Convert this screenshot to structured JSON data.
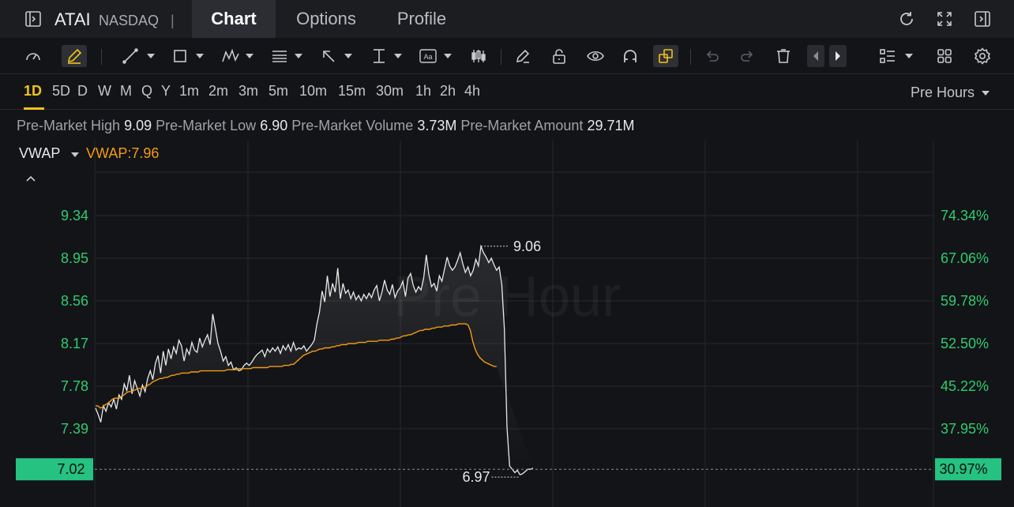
{
  "header": {
    "ticker": "ATAI",
    "exchange": "NASDAQ",
    "separator": "|",
    "tabs": [
      {
        "label": "Chart",
        "active": true
      },
      {
        "label": "Options",
        "active": false
      },
      {
        "label": "Profile",
        "active": false
      }
    ]
  },
  "toolbar": {
    "tools": [
      "speedometer-icon",
      "draw-pencil-icon",
      "trend-line-icon",
      "rectangle-icon",
      "pattern-icon",
      "fib-icon",
      "arrow-icon",
      "measure-icon",
      "text-icon",
      "candles-icon",
      "eraser-icon",
      "unlock-icon",
      "eye-icon",
      "magnet-icon",
      "link-icon",
      "undo-icon",
      "redo-icon",
      "trash-icon",
      "prev-icon",
      "next-icon",
      "layout-list-icon",
      "grid-icon",
      "gear-icon"
    ]
  },
  "intervals": {
    "items": [
      "1D",
      "5D",
      "D",
      "W",
      "M",
      "Q",
      "Y",
      "1m",
      "2m",
      "3m",
      "5m",
      "10m",
      "15m",
      "30m",
      "1h",
      "2h",
      "4h"
    ],
    "active": "1D",
    "session": "Pre Hours"
  },
  "info": {
    "high_label": "Pre-Market High",
    "high_value": "9.09",
    "low_label": "Pre-Market Low",
    "low_value": "6.90",
    "volume_label": "Pre-Market Volume",
    "volume_value": "3.73M",
    "amount_label": "Pre-Market Amount",
    "amount_value": "29.71M"
  },
  "indicator": {
    "name": "VWAP",
    "value_text": "VWAP:7.96"
  },
  "colors": {
    "price_line": "#e8e8e8",
    "vwap_line": "#f39c12",
    "axis_text": "#2ecc71",
    "current_badge": "#26c281",
    "accent": "#f0c419"
  },
  "chart_data": {
    "type": "line",
    "watermark": "Pre Hour",
    "y_ticks": [
      "9.34",
      "8.95",
      "8.56",
      "8.17",
      "7.78",
      "7.39"
    ],
    "y_ticks_right": [
      "74.34%",
      "67.06%",
      "59.78%",
      "52.50%",
      "45.22%",
      "37.95%"
    ],
    "current_price": "7.02",
    "current_pct": "30.97%",
    "high_marker": "9.06",
    "low_marker": "6.97",
    "ylim": [
      6.8,
      9.6
    ],
    "series": [
      {
        "role": "price",
        "values": [
          7.58,
          7.52,
          7.45,
          7.6,
          7.55,
          7.63,
          7.59,
          7.66,
          7.57,
          7.7,
          7.66,
          7.8,
          7.74,
          7.88,
          7.71,
          7.83,
          7.76,
          7.69,
          7.79,
          7.73,
          7.85,
          7.92,
          7.84,
          7.99,
          8.06,
          7.9,
          8.1,
          7.97,
          8.12,
          8.03,
          8.14,
          8.08,
          8.2,
          8.15,
          8.01,
          8.12,
          8.07,
          8.18,
          8.11,
          8.09,
          8.22,
          8.14,
          8.2,
          8.25,
          8.16,
          8.44,
          8.31,
          8.17,
          8.1,
          8.01,
          8.05,
          7.97,
          8.0,
          7.93,
          7.95,
          7.92,
          7.93,
          7.97,
          7.99,
          7.97,
          8.0,
          8.04,
          8.07,
          8.09,
          8.11,
          8.05,
          8.12,
          8.09,
          8.13,
          8.1,
          8.14,
          8.08,
          8.15,
          8.11,
          8.16,
          8.1,
          8.18,
          8.11,
          8.13,
          8.12,
          8.15,
          8.1,
          8.13,
          8.16,
          8.2,
          8.35,
          8.46,
          8.65,
          8.55,
          8.79,
          8.6,
          8.72,
          8.64,
          8.86,
          8.58,
          8.72,
          8.63,
          8.66,
          8.58,
          8.64,
          8.57,
          8.61,
          8.56,
          8.62,
          8.58,
          8.63,
          8.59,
          8.66,
          8.7,
          8.56,
          8.64,
          8.75,
          8.66,
          8.62,
          8.71,
          8.59,
          8.65,
          8.68,
          8.74,
          8.6,
          8.77,
          8.81,
          8.7,
          8.64,
          8.69,
          8.66,
          8.77,
          8.98,
          8.8,
          8.69,
          8.72,
          8.65,
          8.79,
          8.74,
          8.85,
          8.96,
          8.88,
          8.84,
          8.87,
          8.93,
          9.0,
          8.9,
          8.82,
          8.87,
          8.79,
          8.84,
          8.94,
          8.88,
          9.06,
          9.0,
          8.96,
          8.91,
          8.95,
          8.89,
          8.84,
          8.87,
          8.71,
          8.3,
          7.4,
          7.05,
          7.02,
          6.99,
          7.01,
          6.97,
          6.98,
          7.0,
          7.02,
          7.02,
          7.03
        ],
        "x_start": 0,
        "x_end": 168
      },
      {
        "role": "vwap",
        "values": [
          7.6,
          7.6,
          7.58,
          7.59,
          7.61,
          7.62,
          7.64,
          7.66,
          7.67,
          7.67,
          7.67,
          7.69,
          7.7,
          7.72,
          7.73,
          7.73,
          7.74,
          7.75,
          7.76,
          7.76,
          7.77,
          7.77,
          7.79,
          7.8,
          7.82,
          7.83,
          7.84,
          7.85,
          7.85,
          7.86,
          7.86,
          7.87,
          7.88,
          7.88,
          7.89,
          7.89,
          7.9,
          7.9,
          7.9,
          7.9,
          7.91,
          7.91,
          7.91,
          7.91,
          7.92,
          7.92,
          7.92,
          7.92,
          7.92,
          7.92,
          7.92,
          7.92,
          7.92,
          7.92,
          7.92,
          7.93,
          7.93,
          7.93,
          7.93,
          7.93,
          7.94,
          7.94,
          7.94,
          7.94,
          7.94,
          7.94,
          7.95,
          7.95,
          7.95,
          7.95,
          7.95,
          7.95,
          7.95,
          7.96,
          7.96,
          7.96,
          7.96,
          7.96,
          7.96,
          7.97,
          7.97,
          7.97,
          7.98,
          7.98,
          8.0,
          8.02,
          8.04,
          8.06,
          8.07,
          8.08,
          8.09,
          8.1,
          8.1,
          8.11,
          8.12,
          8.12,
          8.13,
          8.13,
          8.13,
          8.14,
          8.14,
          8.15,
          8.15,
          8.16,
          8.16,
          8.16,
          8.17,
          8.17,
          8.17,
          8.17,
          8.18,
          8.18,
          8.18,
          8.18,
          8.19,
          8.19,
          8.19,
          8.19,
          8.19,
          8.2,
          8.2,
          8.2,
          8.2,
          8.2,
          8.21,
          8.21,
          8.22,
          8.22,
          8.23,
          8.24,
          8.24,
          8.25,
          8.25,
          8.26,
          8.27,
          8.28,
          8.29,
          8.29,
          8.3,
          8.3,
          8.3,
          8.31,
          8.31,
          8.32,
          8.32,
          8.32,
          8.33,
          8.33,
          8.33,
          8.34,
          8.34,
          8.34,
          8.35,
          8.35,
          8.35,
          8.35,
          8.34,
          8.29,
          8.19,
          8.12,
          8.07,
          8.04,
          8.02,
          8.0,
          7.99,
          7.98,
          7.97,
          7.96,
          7.96
        ],
        "x_start": 0,
        "x_end": 154
      }
    ]
  }
}
